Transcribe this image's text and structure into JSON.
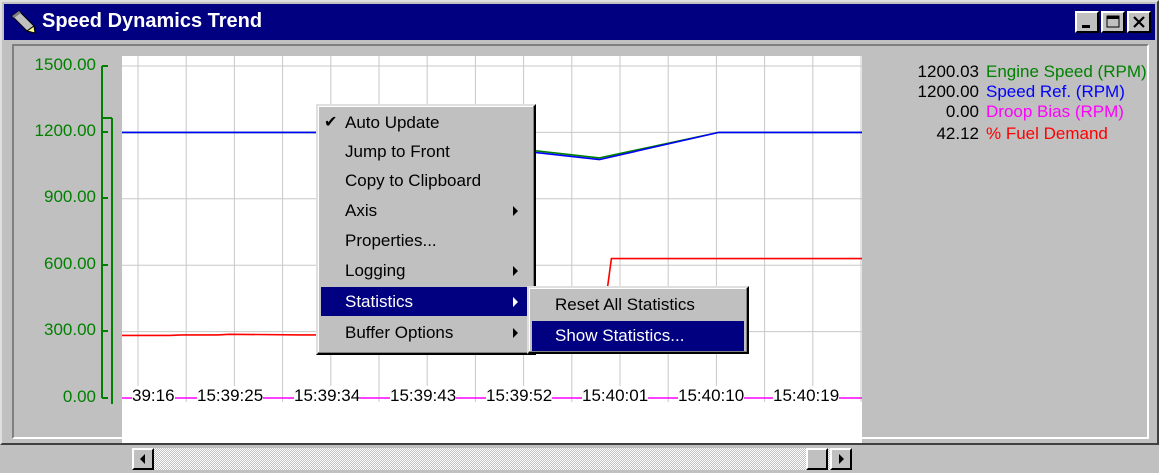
{
  "window": {
    "title": "Speed Dynamics Trend",
    "icon": "pencil-icon",
    "controls": [
      "minimize-icon",
      "maximize-icon",
      "close-icon"
    ]
  },
  "chart_data": {
    "type": "line",
    "title": "",
    "ylim": [
      0,
      1500
    ],
    "y_ticks": [
      "1500.00",
      "1200.00",
      "900.00",
      "600.00",
      "300.00",
      "0.00"
    ],
    "x_tick_labels": [
      "39:16",
      "15:39:25",
      "15:39:34",
      "15:39:43",
      "15:39:52",
      "15:40:01",
      "15:40:10",
      "15:40:19"
    ],
    "grid": true,
    "axis_color": "#008000",
    "series": [
      {
        "name": "Engine Speed (RPM)",
        "color": "#008000",
        "x": [
          0,
          10,
          18.8,
          30,
          40,
          50,
          62
        ],
        "y": [
          1200,
          1200,
          1200,
          1145,
          1085,
          1200,
          1200
        ]
      },
      {
        "name": "Speed Ref. (RPM)",
        "color": "#0000ff",
        "x": [
          0,
          10,
          18.8,
          30,
          40,
          50,
          62
        ],
        "y": [
          1200,
          1200,
          1200,
          1137,
          1077,
          1200,
          1200
        ]
      },
      {
        "name": "Droop Bias (RPM)",
        "color": "#ff00ff",
        "x": [
          0,
          62
        ],
        "y": [
          0,
          0
        ]
      },
      {
        "name": "% Fuel Demand",
        "color": "#ff0000",
        "x": [
          0,
          4,
          5,
          8,
          9,
          15,
          18,
          25,
          30,
          40,
          41,
          62
        ],
        "y": [
          283,
          283,
          285,
          285,
          288,
          285,
          285,
          265,
          250,
          228,
          630,
          630
        ]
      }
    ]
  },
  "legend": [
    {
      "value": "1200.03",
      "name": "Engine Speed (RPM)",
      "color": "#008000"
    },
    {
      "value": "1200.00",
      "name": "Speed Ref. (RPM)",
      "color": "#0000ff"
    },
    {
      "value": "0.00",
      "name": "Droop Bias (RPM)",
      "color": "#ff00ff"
    },
    {
      "value": "42.12",
      "name": "% Fuel Demand",
      "color": "#ff0000"
    }
  ],
  "context_menu": {
    "items": [
      {
        "label": "Auto Update",
        "checked": true,
        "submenu": false
      },
      {
        "label": "Jump to Front",
        "checked": false,
        "submenu": false
      },
      {
        "label": "Copy to Clipboard",
        "checked": false,
        "submenu": false
      },
      {
        "label": "Axis",
        "checked": false,
        "submenu": true
      },
      {
        "label": "Properties...",
        "checked": false,
        "submenu": false
      },
      {
        "label": "Logging",
        "checked": false,
        "submenu": true
      },
      {
        "label": "Statistics",
        "checked": false,
        "submenu": true,
        "highlighted": true
      },
      {
        "label": "Buffer Options",
        "checked": false,
        "submenu": true
      }
    ],
    "check_mark": "✔"
  },
  "submenu": {
    "items": [
      {
        "label": "Reset All Statistics",
        "highlighted": false
      },
      {
        "label": "Show Statistics...",
        "highlighted": true
      }
    ]
  },
  "scrollbar": {
    "left_arrow": "scroll-left-arrow-icon",
    "right_arrow": "scroll-right-arrow-icon"
  }
}
